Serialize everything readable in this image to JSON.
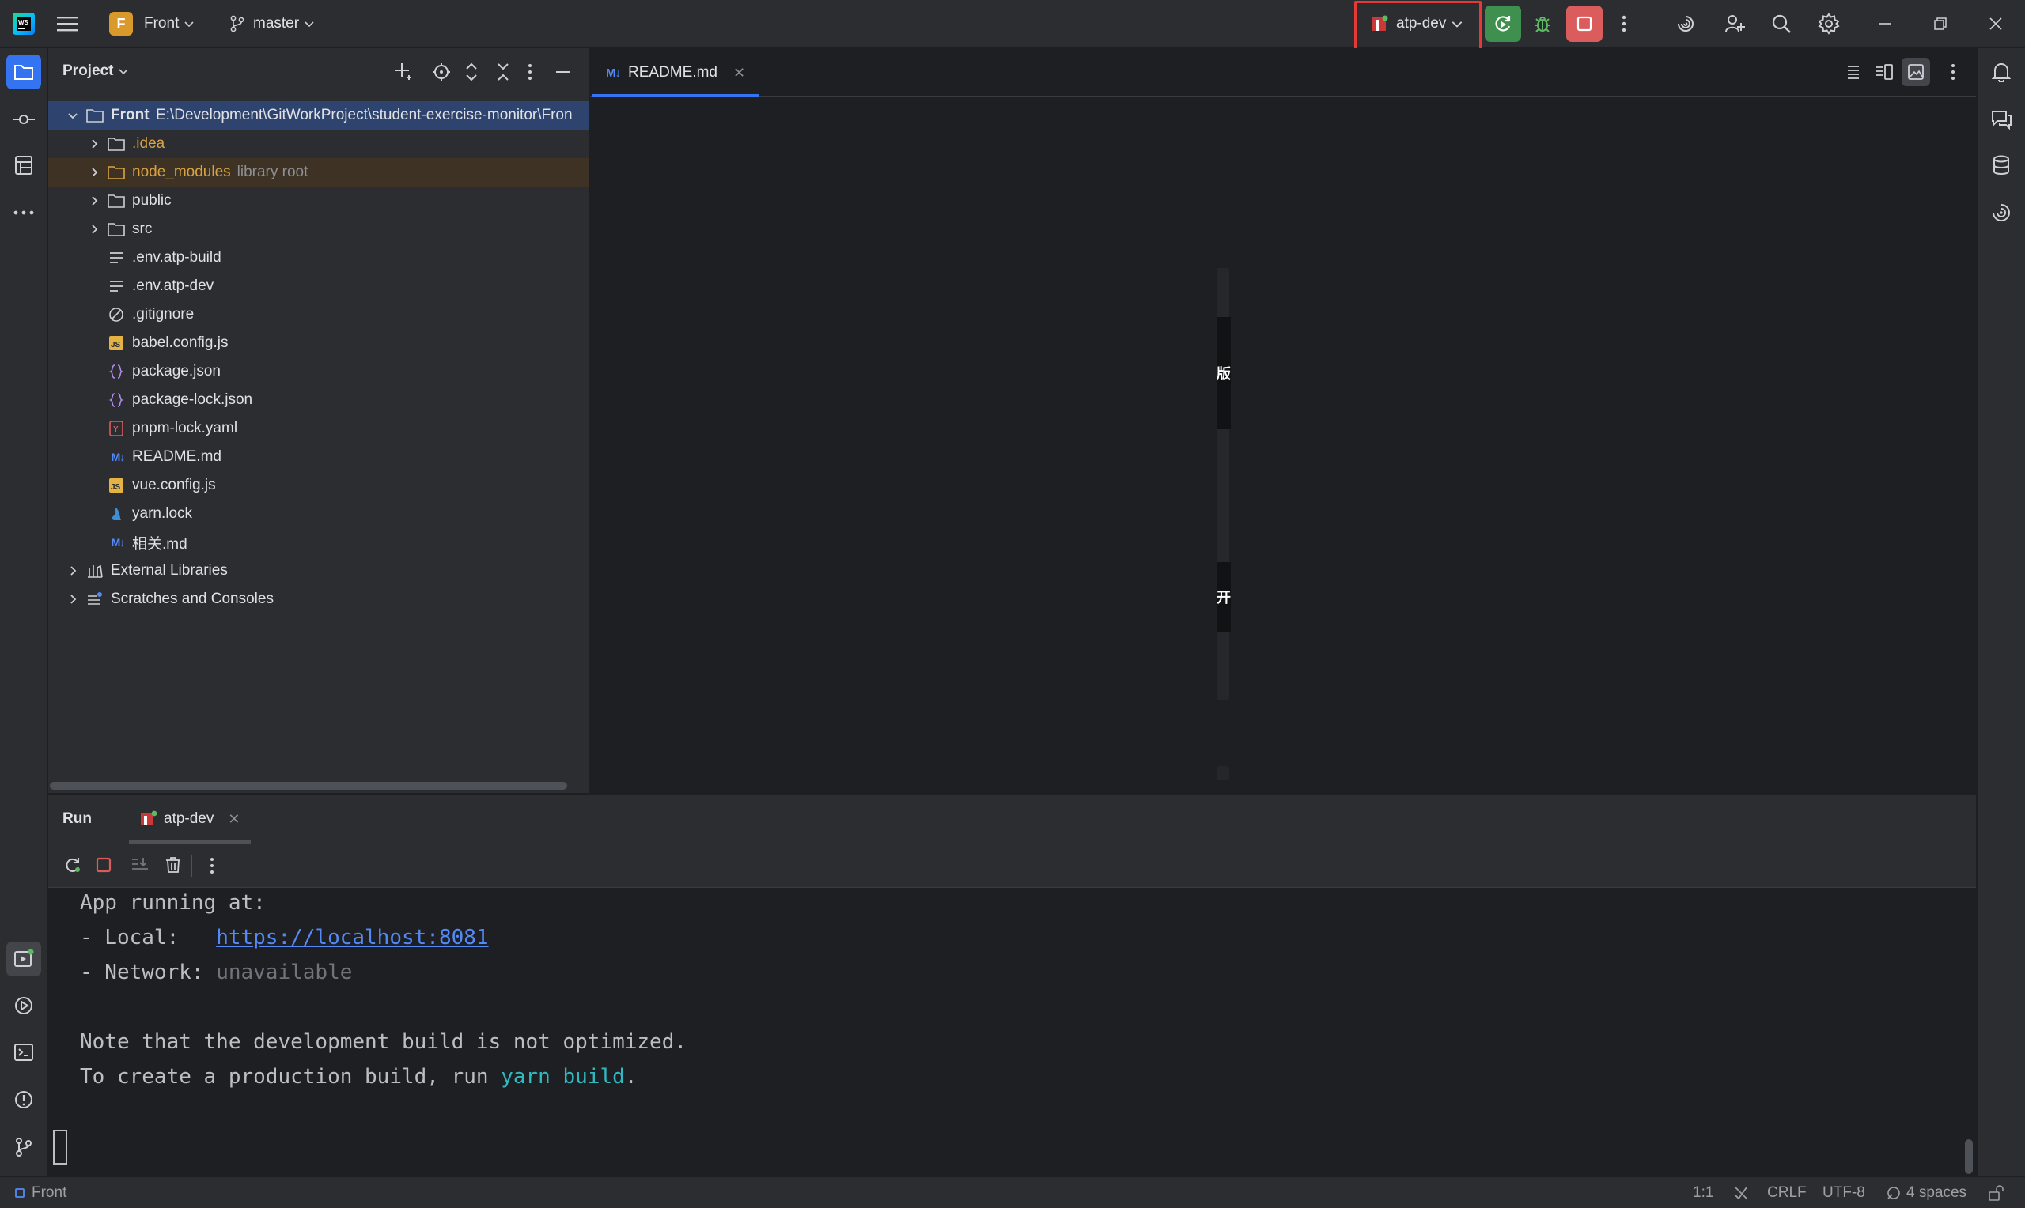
{
  "titlebar": {
    "project_initial": "F",
    "project_name": "Front",
    "branch": "master",
    "run_config": "atp-dev"
  },
  "project_panel": {
    "title": "Project",
    "root": {
      "name": "Front",
      "path": "E:\\Development\\GitWorkProject\\student-exercise-monitor\\Fron"
    },
    "items": [
      {
        "label": ".idea",
        "note": ""
      },
      {
        "label": "node_modules",
        "note": "library root"
      },
      {
        "label": "public",
        "note": ""
      },
      {
        "label": "src",
        "note": ""
      },
      {
        "label": ".env.atp-build",
        "note": ""
      },
      {
        "label": ".env.atp-dev",
        "note": ""
      },
      {
        "label": ".gitignore",
        "note": ""
      },
      {
        "label": "babel.config.js",
        "note": ""
      },
      {
        "label": "package.json",
        "note": ""
      },
      {
        "label": "package-lock.json",
        "note": ""
      },
      {
        "label": "pnpm-lock.yaml",
        "note": ""
      },
      {
        "label": "README.md",
        "note": ""
      },
      {
        "label": "vue.config.js",
        "note": ""
      },
      {
        "label": "yarn.lock",
        "note": ""
      },
      {
        "label": "相关.md",
        "note": ""
      }
    ],
    "external_libraries": "External Libraries",
    "scratches": "Scratches and Consoles"
  },
  "editor": {
    "tab_icon": "M↓",
    "tab_label": "README.md",
    "preview_chars": [
      "版",
      "开"
    ]
  },
  "run_panel": {
    "title": "Run",
    "tab_label": "atp-dev",
    "console": {
      "line1": "App running at:",
      "local_prefix": "- Local:   ",
      "local_url": "https://localhost:8081",
      "network_prefix": "- Network: ",
      "network_value": "unavailable",
      "note_line": "Note that the development build is not optimized.",
      "prod_prefix": "To create a production build, run ",
      "prod_cmd": "yarn build",
      "prod_suffix": "."
    }
  },
  "statusbar": {
    "project": "Front",
    "position": "1:1",
    "line_ending": "CRLF",
    "encoding": "UTF-8",
    "indent": "4 spaces"
  },
  "colors": {
    "accent": "#3574f0",
    "run_green": "#3f8f4f",
    "stop_red": "#db5c5c",
    "highlight_box": "#e53935"
  }
}
